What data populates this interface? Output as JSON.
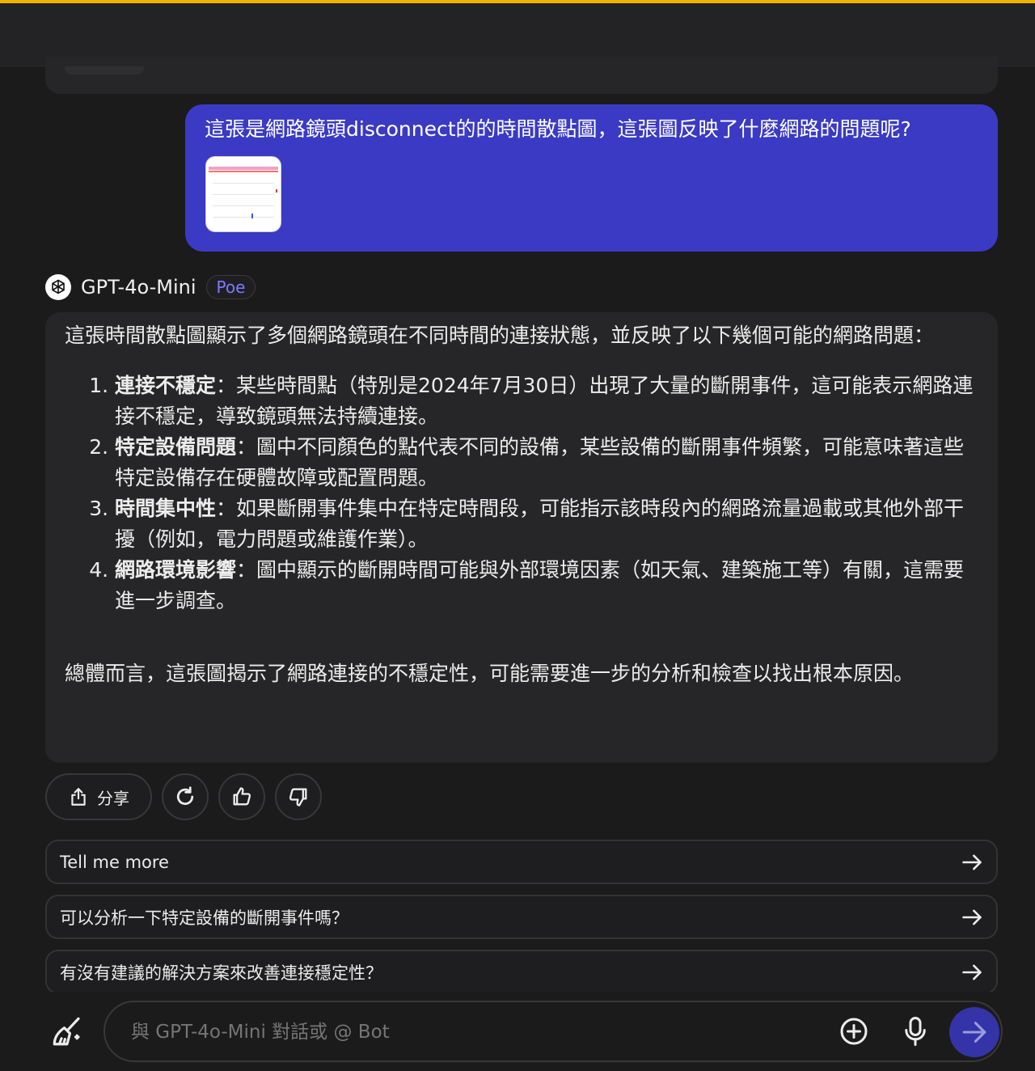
{
  "conversation": {
    "user_message": {
      "text": "這張是網路鏡頭disconnect的的時間散點圖，這張圖反映了什麼網路的問題呢?",
      "attachment": "scatter-plot-thumbnail"
    },
    "bot": {
      "name": "GPT-4o-Mini",
      "badge": "Poe",
      "intro": "這張時間散點圖顯示了多個網路鏡頭在不同時間的連接狀態，並反映了以下幾個可能的網路問題：",
      "points": [
        {
          "title": "連接不穩定",
          "text": "：某些時間點（特別是2024年7月30日）出現了大量的斷開事件，這可能表示網路連接不穩定，導致鏡頭無法持續連接。"
        },
        {
          "title": "特定設備問題",
          "text": "：圖中不同顏色的點代表不同的設備，某些設備的斷開事件頻繁，可能意味著這些特定設備存在硬體故障或配置問題。"
        },
        {
          "title": "時間集中性",
          "text": "：如果斷開事件集中在特定時間段，可能指示該時段內的網路流量過載或其他外部干擾（例如，電力問題或維護作業）。"
        },
        {
          "title": "網路環境影響",
          "text": "：圖中顯示的斷開時間可能與外部環境因素（如天氣、建築施工等）有關，這需要進一步調查。"
        }
      ],
      "summary": "總體而言，這張圖揭示了網路連接的不穩定性，可能需要進一步的分析和檢查以找出根本原因。"
    }
  },
  "actions": {
    "share_label": "分享",
    "icons": [
      "share-icon",
      "retry-icon",
      "thumbs-up-icon",
      "thumbs-down-icon"
    ]
  },
  "suggestions": [
    "Tell me more",
    "可以分析一下特定設備的斷開事件嗎？",
    "有沒有建議的解決方案來改善連接穩定性？"
  ],
  "composer": {
    "placeholder": "與 GPT-4o-Mini 對話或 @ Bot"
  },
  "colors": {
    "background": "#1b1b1c",
    "user_bubble": "#3a3ac4",
    "card": "#262628",
    "accent_top": "#f0b400",
    "badge": "#7b7bff",
    "send_button": "#3434a8"
  }
}
